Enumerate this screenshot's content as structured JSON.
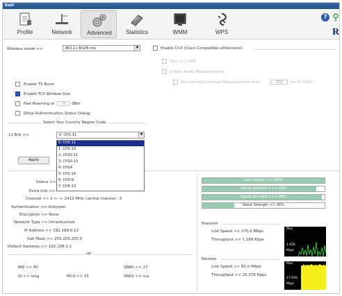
{
  "title_bar": {
    "label": "RaUI"
  },
  "toolbar": {
    "buttons": [
      {
        "label": "Profile"
      },
      {
        "label": "Network"
      },
      {
        "label": "Advanced"
      },
      {
        "label": "Statistics"
      },
      {
        "label": "WMM"
      },
      {
        "label": "WPS"
      }
    ],
    "brand_letter": "R",
    "help_glyph": "?"
  },
  "advanced": {
    "wireless_mode_label": "Wireless mode >>",
    "wireless_mode_value": "802.11 B/G/N mix",
    "ccx": {
      "enable_label": "Enable CCX (Cisco Compatible eXtensions)",
      "turn_on_cckm": "Turn on CCKM",
      "radio_measurements": "Enable Radio Measurements",
      "non_serving_label": "Non-Serving Channel Measurements limit",
      "non_serving_value": "250",
      "non_serving_unit": "ms (0-2000)"
    },
    "tx_burst_label": "Enable TX Burst",
    "tcp_window_label": "Enable TCP Window Size",
    "fast_roaming_label": "Fast Roaming at",
    "fast_roaming_value": "-70",
    "fast_roaming_unit": "dBm",
    "auth_dialog_label": "Show Authentication Status Dialog",
    "region_title": "Select Your Country Region Code",
    "band_label": "11 B/G >>",
    "region_value": "0: CH1-11",
    "region_options": [
      "0: CH1-11",
      "1: CH1-13",
      "2: CH10-11",
      "3: CH10-13",
      "4: CH14",
      "5: CH1-14",
      "6: CH3-9",
      "7: CH5-13"
    ],
    "apply_label": "Apply"
  },
  "status": {
    "status_label": "Status >>",
    "extra_info_label": "Extra Info >>",
    "channel": "Channel >> 1 <--> 2412 MHz; central channel : 3",
    "authentication": "Authentication >> Unknown",
    "encryption": "Encryption >> None",
    "network_type": "Network Type >> Infrastructure",
    "ip_address": "IP Address >> 192.168.0.13",
    "sub_mask": "Sub Mask >> 255.255.255.0",
    "default_gateway": "Default Gateway >> 192.168.0.1",
    "ht_label": "HT",
    "bw": "BW >> 40",
    "gi": "GI >> long",
    "mcs": "MCS >> 15",
    "snr0": "SNR0 >> 27",
    "snr1": "SNR1 >> n/a"
  },
  "signal": {
    "bars": [
      {
        "label": "Link Quality >> 100%",
        "fraction": 1.0
      },
      {
        "label": "Signal Strength 1 >> 93%",
        "fraction": 0.93
      },
      {
        "label": "Signal Strength 2 >> 98%",
        "fraction": 0.98
      },
      {
        "label": "Noise Strength >> 26%",
        "fraction": 0.26
      }
    ]
  },
  "transmit": {
    "title": "Transmit",
    "link_speed": "Link Speed >> 270.0 Mbps",
    "throughput": "Throughput >> 1.168 Kbps",
    "graph_max": "Max",
    "graph_value": "1.936",
    "graph_unit": "Kbps"
  },
  "receive": {
    "title": "Receive",
    "link_speed": "Link Speed >> 81.0 Mbps",
    "throughput": "Throughput >> 25.376 Kbps",
    "graph_max": "Max",
    "graph_value": "27.936",
    "graph_unit": "Kbps"
  },
  "colors": {
    "bar_fill": "#97ccb1",
    "selection": "#1c2d8d",
    "tx_graph_line": "#38c43a",
    "rx_graph_fill": "#f4ee1b"
  }
}
